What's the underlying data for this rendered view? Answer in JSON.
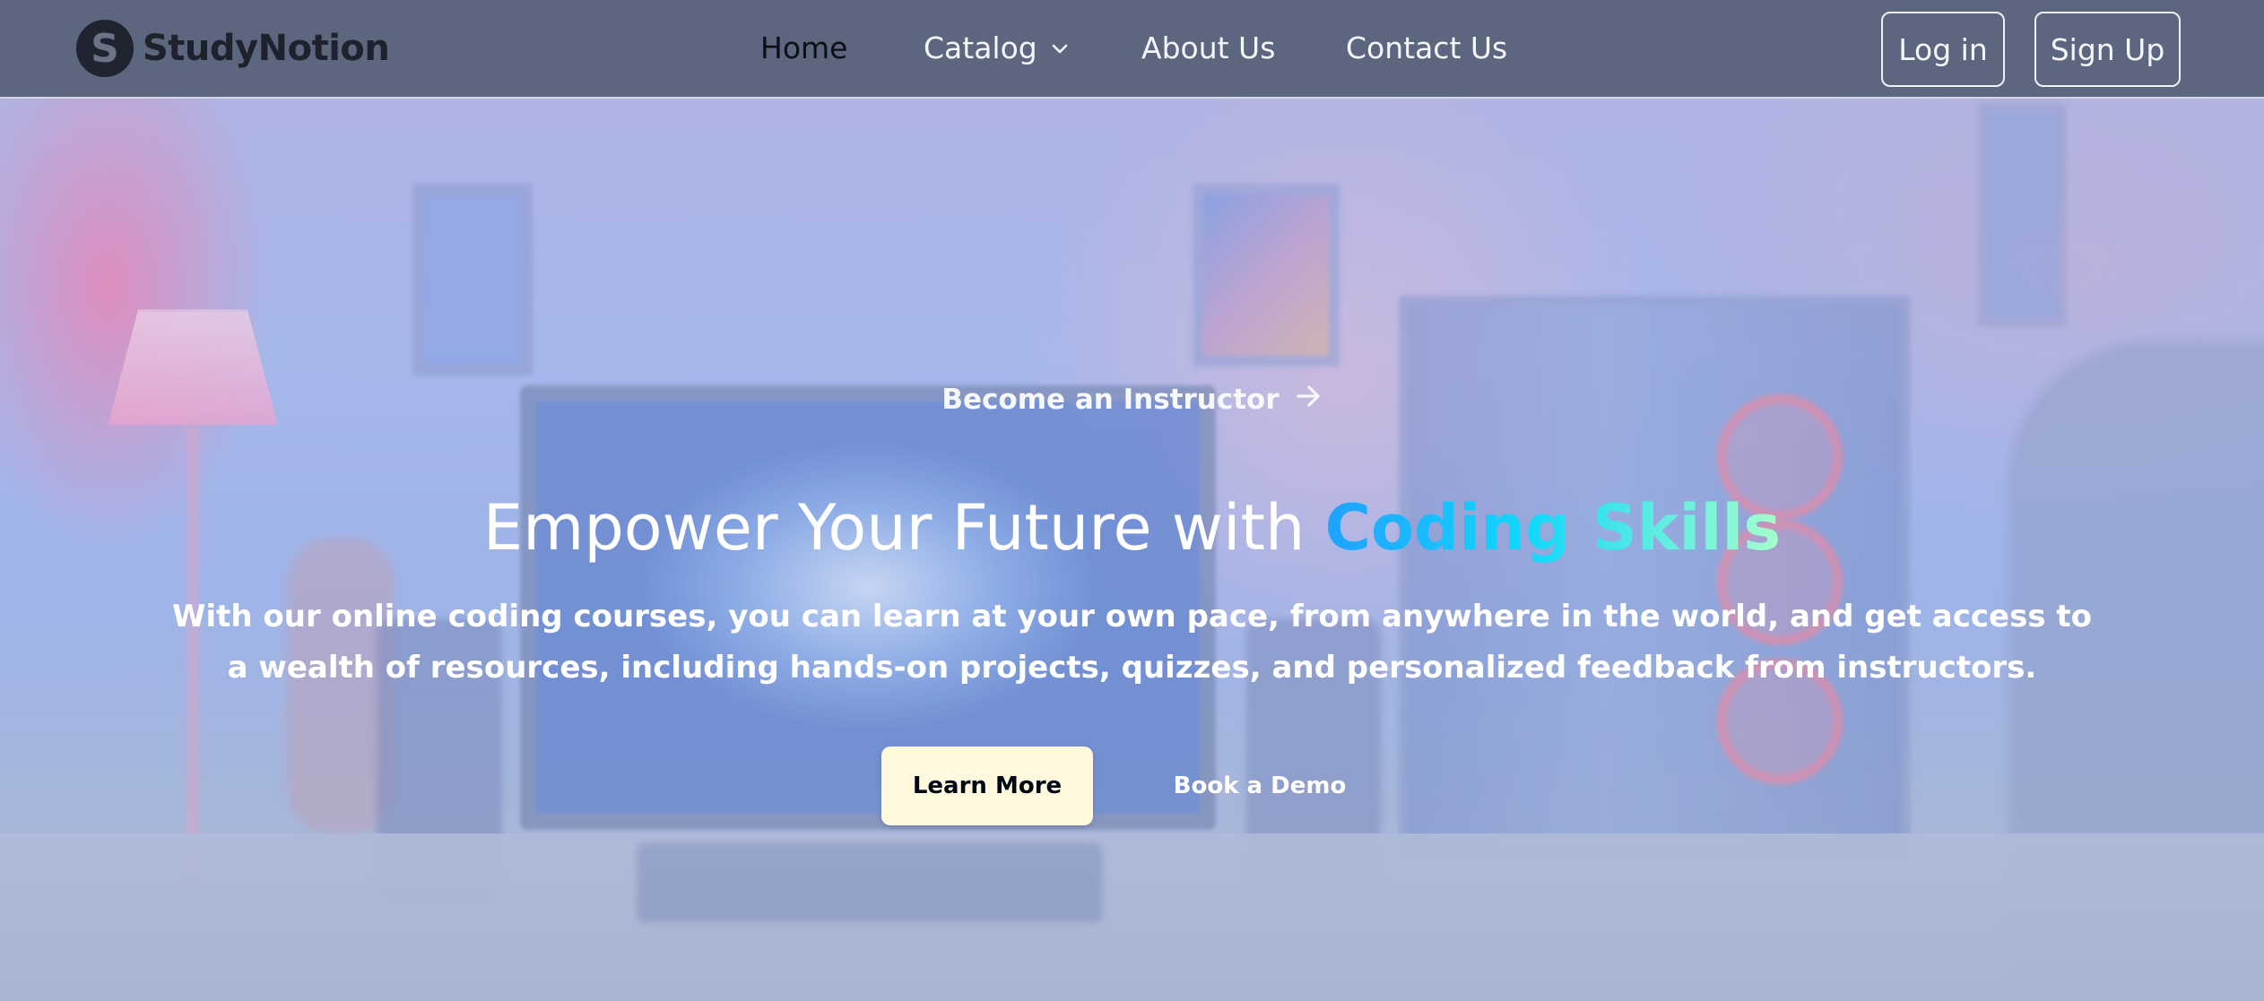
{
  "brand": {
    "name": "StudyNotion",
    "logo_letter": "S"
  },
  "nav": {
    "items": [
      {
        "label": "Home",
        "active": true
      },
      {
        "label": "Catalog",
        "has_dropdown": true
      },
      {
        "label": "About Us"
      },
      {
        "label": "Contact Us"
      }
    ],
    "login_label": "Log in",
    "signup_label": "Sign Up"
  },
  "hero": {
    "instructor_link": "Become an Instructor",
    "headline_prefix": "Empower Your Future with ",
    "headline_highlight": "Coding Skills",
    "description": "With our online coding courses, you can learn at your own pace, from anywhere in the world, and get access to a wealth of resources, including hands-on projects, quizzes, and personalized feedback from instructors.",
    "primary_button": "Learn More",
    "secondary_button": "Book a Demo"
  },
  "icons": {
    "catalog_dropdown": "chevron-down-icon",
    "instructor_arrow": "arrow-right-icon"
  },
  "colors": {
    "navbar_bg": "#556076",
    "active_nav": "#0c0f16",
    "primary_button_bg": "#fff8dc",
    "highlight_gradient": [
      "#1fa2ff",
      "#12d8fa",
      "#a6ffcb"
    ]
  }
}
